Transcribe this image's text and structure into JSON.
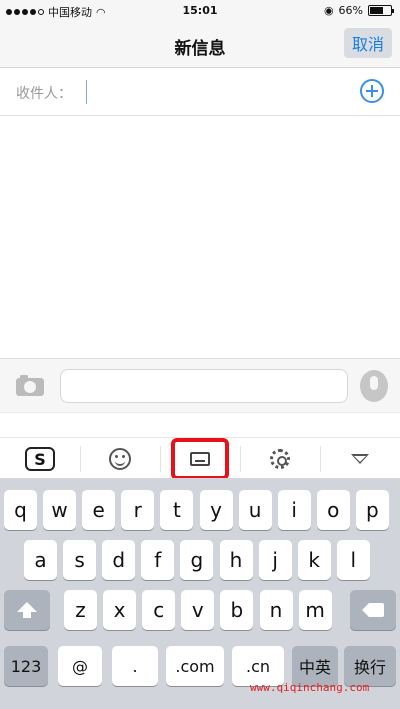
{
  "status_bar": {
    "carrier": "中国移动",
    "time": "15:01",
    "battery": "66%",
    "battery_level": 0.66
  },
  "nav": {
    "title": "新信息",
    "cancel_label": "取消"
  },
  "recipient": {
    "label": "收件人："
  },
  "keyboard": {
    "row1": [
      "q",
      "w",
      "e",
      "r",
      "t",
      "y",
      "u",
      "i",
      "o",
      "p"
    ],
    "row2": [
      "a",
      "s",
      "d",
      "f",
      "g",
      "h",
      "j",
      "k",
      "l"
    ],
    "row3": [
      "z",
      "x",
      "c",
      "v",
      "b",
      "n",
      "m"
    ],
    "numbers_label": "123",
    "at_label": "@",
    "dot_label": ".",
    "com_label": ".com",
    "cn_label": ".cn",
    "lang_label": "中英",
    "return_label": "换行"
  },
  "toolbar": {
    "sogou_label": "S"
  },
  "watermark": "www.qiqinchang.com"
}
